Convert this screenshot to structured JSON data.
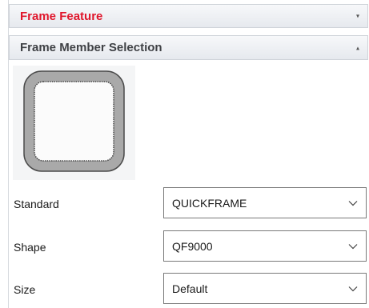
{
  "frame_feature": {
    "title": "Frame Feature",
    "collapse_glyph": "▾",
    "icon": "chevron-down-icon",
    "title_color": "#e0162b"
  },
  "member_selection": {
    "title": "Frame Member Selection",
    "collapse_glyph": "▴",
    "icon": "chevron-up-icon",
    "preview_icon": "rounded-square-profile-icon",
    "fields": {
      "standard": {
        "label": "Standard",
        "value": "QUICKFRAME"
      },
      "shape": {
        "label": "Shape",
        "value": "QF9000"
      },
      "size": {
        "label": "Size",
        "value": "Default"
      }
    }
  }
}
